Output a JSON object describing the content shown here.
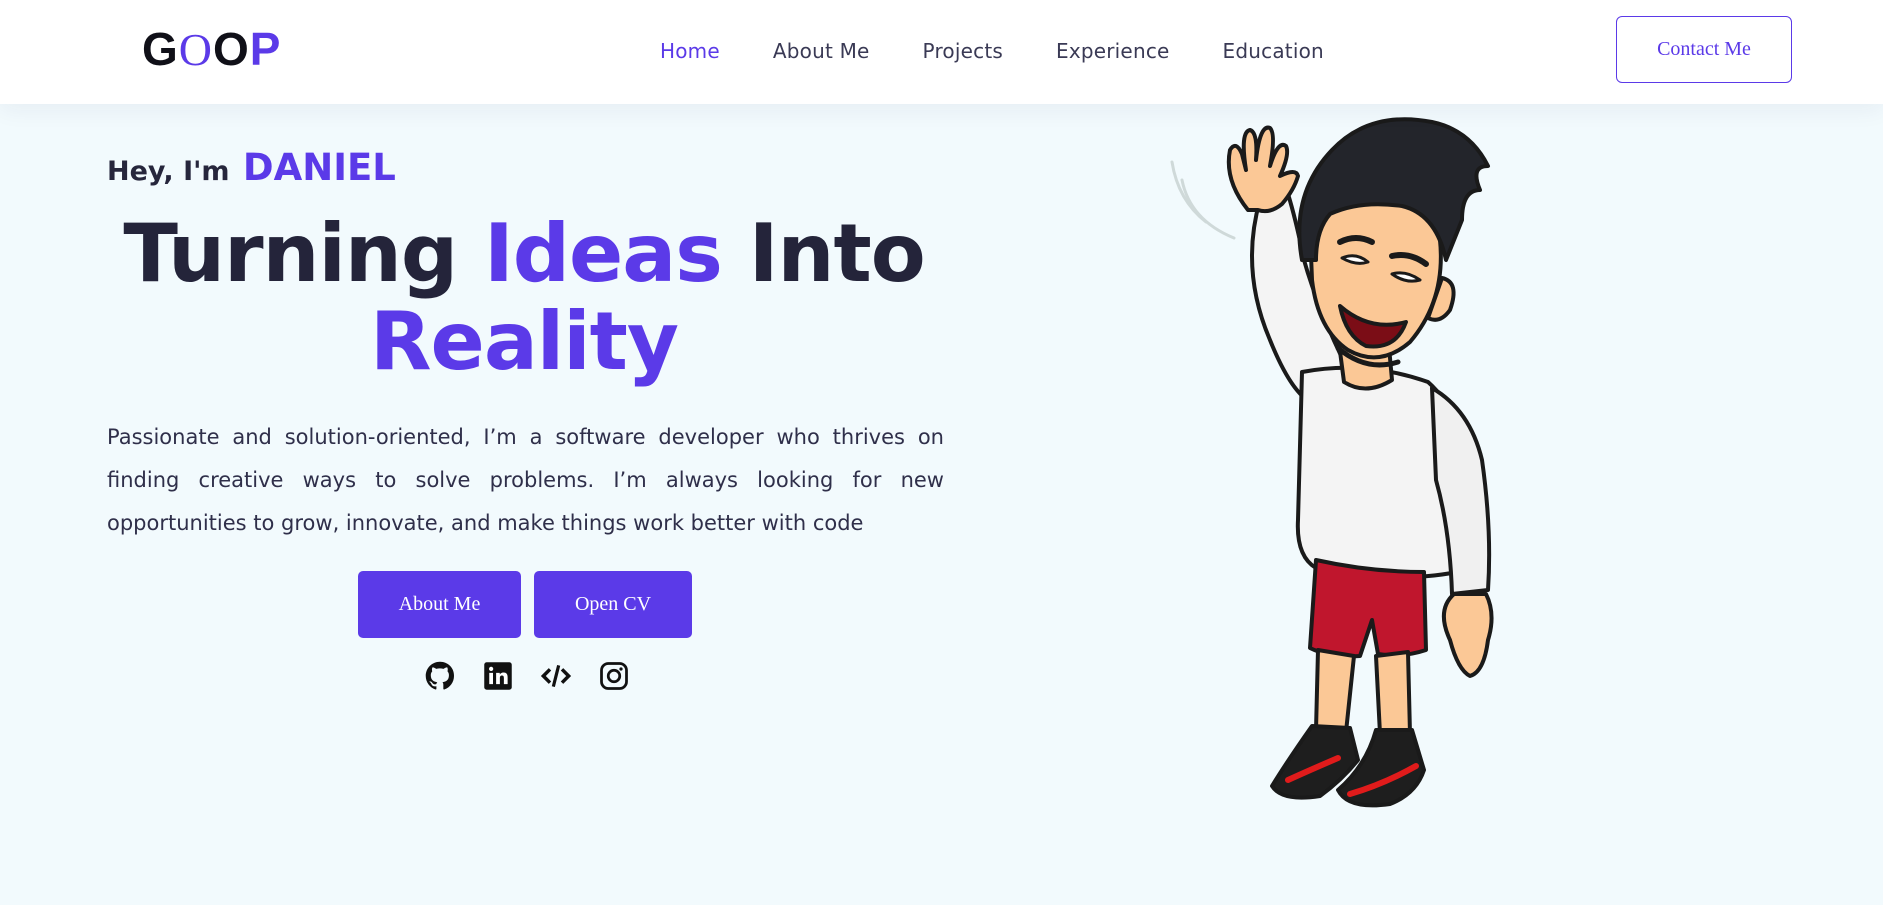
{
  "header": {
    "logo": {
      "l1": "G",
      "l2": "O",
      "l3": "O",
      "l4": "P"
    },
    "nav": [
      {
        "label": "Home",
        "active": true
      },
      {
        "label": "About Me"
      },
      {
        "label": "Projects"
      },
      {
        "label": "Experience"
      },
      {
        "label": "Education"
      }
    ],
    "contact_label": "Contact Me"
  },
  "hero": {
    "greeting_prefix": "Hey, I'm",
    "name": "DANIEL",
    "headline": {
      "w1": "Turning",
      "w2": "Ideas",
      "w3": "Into",
      "w4": "Reality"
    },
    "description": "Passionate and solution-oriented, I’m a software developer who thrives on finding creative ways to solve problems. I’m always looking for new opportunities to grow, innovate, and make things work better with code",
    "buttons": {
      "about": "About Me",
      "cv": "Open CV"
    },
    "socials": [
      "github-icon",
      "linkedin-icon",
      "code-icon",
      "instagram-icon"
    ]
  },
  "colors": {
    "accent": "#5b3ae8",
    "text_dark": "#24243a",
    "background": "#f2fafd"
  }
}
